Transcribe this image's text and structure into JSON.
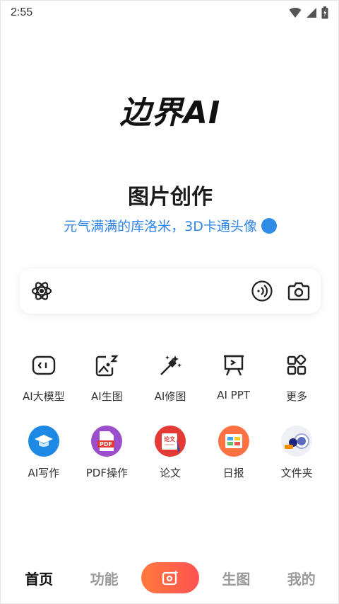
{
  "status_bar": {
    "time": "2:55"
  },
  "logo": {
    "text": "边界AI"
  },
  "hero": {
    "title": "图片创作",
    "subtitle": "元气满满的库洛米，3D卡通头像"
  },
  "search": {
    "left_icon": "atom-icon",
    "voice_icon": "voice-icon",
    "camera_icon": "camera-icon"
  },
  "features_row1": [
    {
      "label": "AI大模型",
      "icon": "chat-bubble-icon"
    },
    {
      "label": "AI生图",
      "icon": "image-gen-icon"
    },
    {
      "label": "AI修图",
      "icon": "magic-wand-icon"
    },
    {
      "label": "AI PPT",
      "icon": "presentation-icon"
    },
    {
      "label": "更多",
      "icon": "grid-more-icon"
    }
  ],
  "features_row2": [
    {
      "label": "AI写作",
      "icon": "graduation-cap-icon",
      "color": "#1e88e5"
    },
    {
      "label": "PDF操作",
      "icon": "pdf-icon",
      "color": "#9c4dcc"
    },
    {
      "label": "论文",
      "icon": "thesis-icon",
      "color": "#e53935"
    },
    {
      "label": "日报",
      "icon": "daily-report-icon",
      "color": "#ff7043"
    },
    {
      "label": "文件夹",
      "icon": "folder-icon",
      "color": "#e8eaf0"
    }
  ],
  "bottom_nav": {
    "home": "首页",
    "features": "功能",
    "generate": "生图",
    "mine": "我的"
  },
  "colors": {
    "accent_blue": "#2f86e8",
    "nav_gradient_start": "#ff7a3d",
    "nav_gradient_end": "#ff5252"
  }
}
